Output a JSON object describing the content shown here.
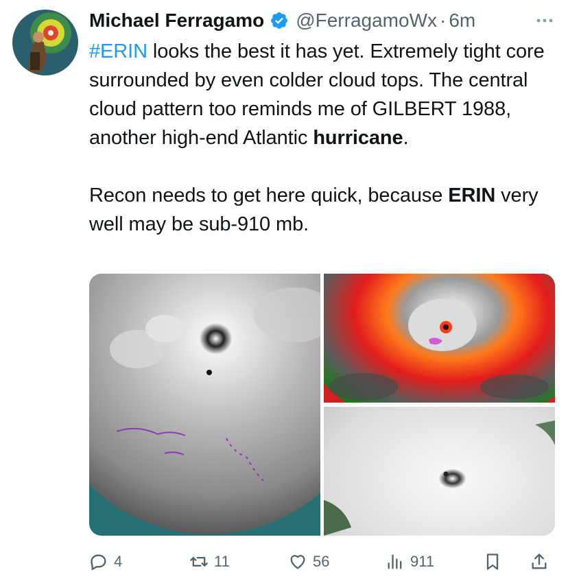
{
  "author": {
    "name": "Michael Ferragamo",
    "handle": "@FerragamoWx",
    "separator": "·",
    "time": "6m",
    "verified": true
  },
  "tweet": {
    "p1_hashtag": "#ERIN",
    "p1_text1": " looks the best it has yet. Extremely tight core surrounded by even colder cloud tops. The central cloud pattern too reminds me of GILBERT 1988, another high-end Atlantic ",
    "p1_bold": "hurricane",
    "p1_text2": ".",
    "p2_text1": "Recon needs to get here quick, because ",
    "p2_bold": "ERIN",
    "p2_text2": " very well may be sub-910 mb."
  },
  "media": {
    "images": [
      {
        "icon": "satellite-visible-ir-icon"
      },
      {
        "icon": "satellite-infrared-enhanced-icon"
      },
      {
        "icon": "satellite-true-color-icon"
      }
    ]
  },
  "actions": {
    "replies": "4",
    "retweets": "11",
    "likes": "56",
    "views": "911"
  },
  "colors": {
    "accent": "#1d9bf0",
    "secondary_text": "#536471",
    "text": "#0f1419"
  }
}
